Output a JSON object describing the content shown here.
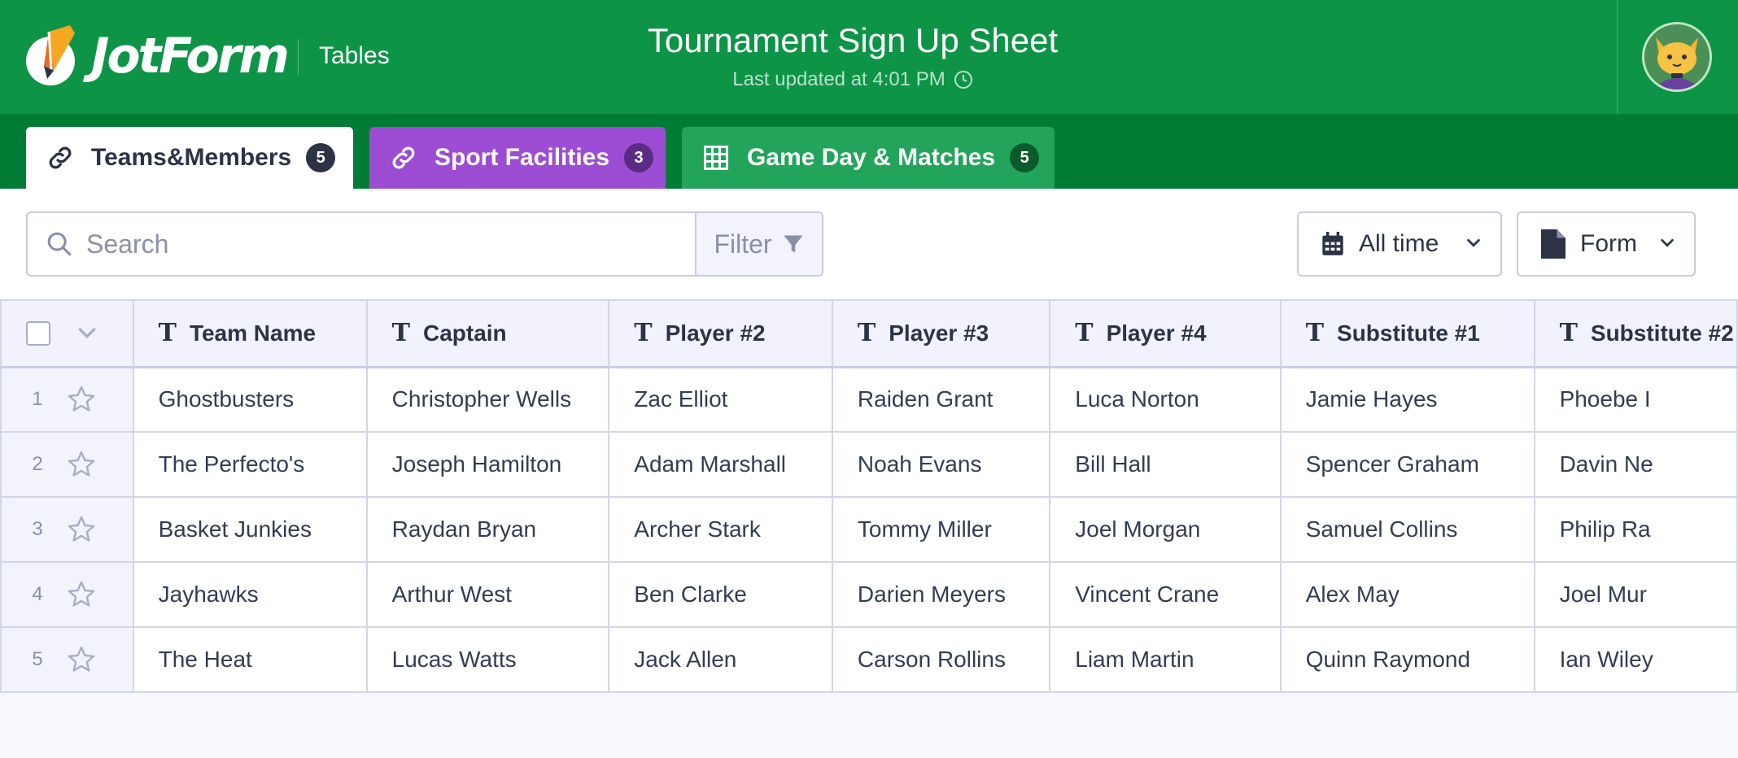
{
  "header": {
    "logo_text": "JotForm",
    "app_label": "Tables",
    "title": "Tournament Sign Up Sheet",
    "subtitle": "Last updated at 4:01 PM"
  },
  "tabs": [
    {
      "label": "Teams&Members",
      "count": "5",
      "icon": "link-icon"
    },
    {
      "label": "Sport Facilities",
      "count": "3",
      "icon": "link-icon"
    },
    {
      "label": "Game Day & Matches",
      "count": "5",
      "icon": "grid-icon"
    }
  ],
  "toolbar": {
    "search_placeholder": "Search",
    "filter_label": "Filter",
    "time_label": "All time",
    "form_label": "Form"
  },
  "table": {
    "columns": [
      "Team Name",
      "Captain",
      "Player #2",
      "Player #3",
      "Player #4",
      "Substitute #1",
      "Substitute #2"
    ],
    "rows": [
      {
        "num": "1",
        "cells": [
          "Ghostbusters",
          "Christopher Wells",
          "Zac Elliot",
          "Raiden Grant",
          "Luca Norton",
          "Jamie Hayes",
          "Phoebe I"
        ]
      },
      {
        "num": "2",
        "cells": [
          "The Perfecto's",
          "Joseph Hamilton",
          "Adam Marshall",
          "Noah Evans",
          "Bill Hall",
          "Spencer Graham",
          "Davin Ne"
        ]
      },
      {
        "num": "3",
        "cells": [
          "Basket Junkies",
          "Raydan Bryan",
          "Archer Stark",
          "Tommy Miller",
          "Joel Morgan",
          "Samuel Collins",
          "Philip Ra"
        ]
      },
      {
        "num": "4",
        "cells": [
          "Jayhawks",
          "Arthur West",
          "Ben Clarke",
          "Darien Meyers",
          "Vincent Crane",
          "Alex May",
          "Joel Mur"
        ]
      },
      {
        "num": "5",
        "cells": [
          "The Heat",
          "Lucas Watts",
          "Jack Allen",
          "Carson Rollins",
          "Liam Martin",
          "Quinn Raymond",
          "Ian Wiley"
        ]
      }
    ]
  },
  "colors": {
    "header_green": "#0e9447",
    "tabbar_green": "#007c35",
    "tab_purple": "#9c4dd3",
    "tab_green": "#23a45b",
    "navy_text": "#2c3345"
  }
}
